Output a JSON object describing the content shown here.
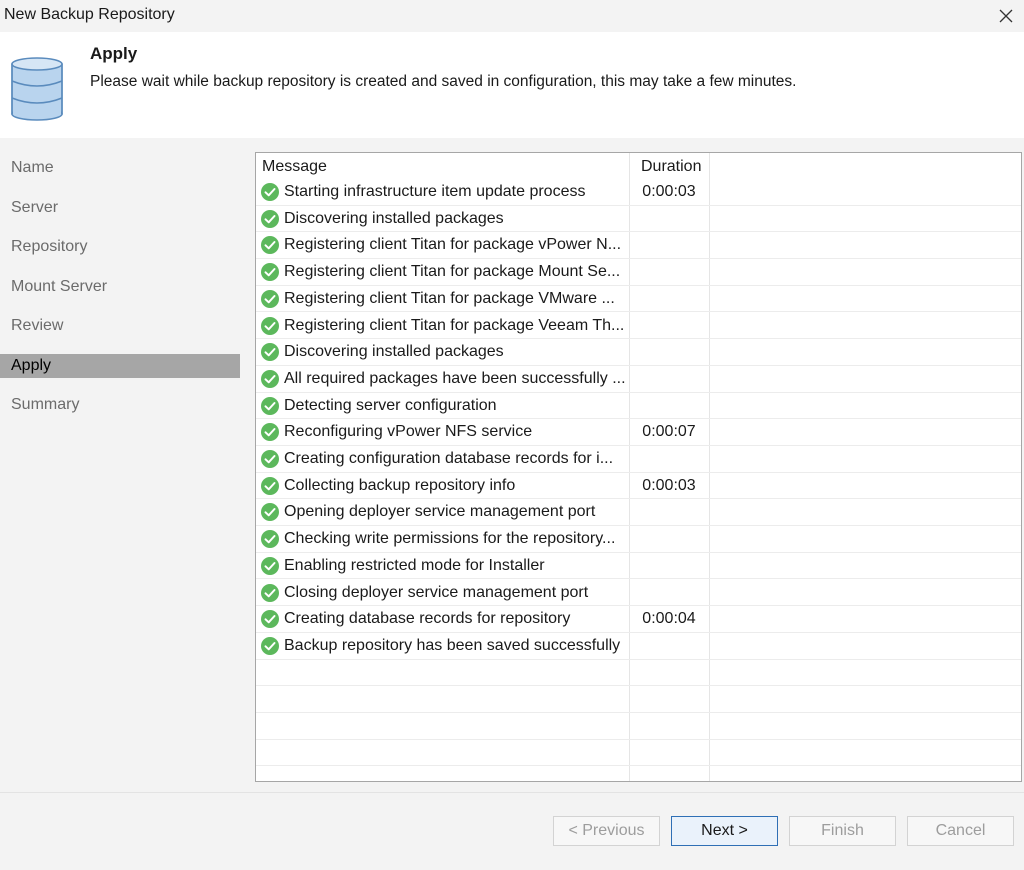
{
  "window": {
    "title": "New Backup Repository",
    "close_icon": "close-icon"
  },
  "header": {
    "icon": "database-icon",
    "title": "Apply",
    "description": "Please wait while backup repository is created and saved in configuration, this may take a few minutes."
  },
  "sidebar": {
    "steps": [
      {
        "label": "Name"
      },
      {
        "label": "Server"
      },
      {
        "label": "Repository"
      },
      {
        "label": "Mount Server"
      },
      {
        "label": "Review"
      },
      {
        "label": "Apply"
      },
      {
        "label": "Summary"
      }
    ],
    "active": "Apply"
  },
  "log": {
    "columns": {
      "message": "Message",
      "duration": "Duration"
    },
    "status_icon": "success-check-icon",
    "rows": [
      {
        "message": "Starting infrastructure item update process",
        "duration": "0:00:03"
      },
      {
        "message": "Discovering installed packages",
        "duration": ""
      },
      {
        "message": "Registering client Titan for package vPower N...",
        "duration": ""
      },
      {
        "message": "Registering client Titan for package Mount Se...",
        "duration": ""
      },
      {
        "message": "Registering client Titan for package VMware ...",
        "duration": ""
      },
      {
        "message": "Registering client Titan for package Veeam Th...",
        "duration": ""
      },
      {
        "message": "Discovering installed packages",
        "duration": ""
      },
      {
        "message": "All required packages have been successfully ...",
        "duration": ""
      },
      {
        "message": "Detecting server configuration",
        "duration": ""
      },
      {
        "message": "Reconfiguring vPower NFS service",
        "duration": "0:00:07"
      },
      {
        "message": "Creating configuration database records for i...",
        "duration": ""
      },
      {
        "message": "Collecting backup repository info",
        "duration": "0:00:03"
      },
      {
        "message": "Opening deployer service management port",
        "duration": ""
      },
      {
        "message": "Checking write permissions for the repository...",
        "duration": ""
      },
      {
        "message": "Enabling restricted mode for Installer",
        "duration": ""
      },
      {
        "message": "Closing deployer service management port",
        "duration": ""
      },
      {
        "message": "Creating database records for repository",
        "duration": "0:00:04"
      },
      {
        "message": "Backup repository has been saved successfully",
        "duration": ""
      }
    ]
  },
  "footer": {
    "previous_label": "< Previous",
    "next_label": "Next >",
    "finish_label": "Finish",
    "cancel_label": "Cancel"
  },
  "colors": {
    "success": "#5cb85c",
    "active_step": "#a6a6a6",
    "primary_border": "#2f6fb5"
  }
}
